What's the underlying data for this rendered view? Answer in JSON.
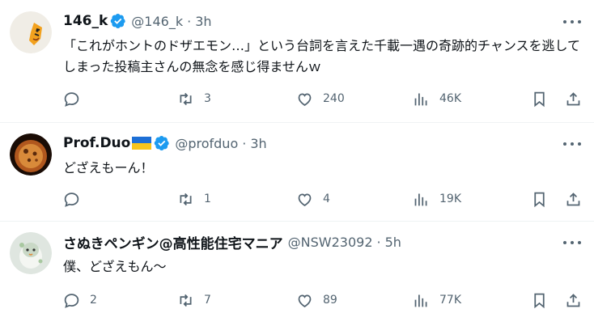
{
  "posts": [
    {
      "name": "146_k",
      "handle": "@146_k",
      "time": "3h",
      "text": "「これがホントのドザエモン…」という台詞を言えた千載一遇の奇跡的チャンスを逃してしまった投稿主さんの無念を感じ得ませんｗ",
      "replies": "",
      "reposts": "3",
      "likes": "240",
      "views": "46K",
      "verified": true,
      "flag": false
    },
    {
      "name": "Prof.Duo",
      "handle": "@profduo",
      "time": "3h",
      "text": "どざえもーん！",
      "replies": "",
      "reposts": "1",
      "likes": "4",
      "views": "19K",
      "verified": true,
      "flag": true
    },
    {
      "name": "さぬきペンギン@高性能住宅マニア",
      "handle": "@NSW23092",
      "time": "5h",
      "text": "僕、どざえもん〜",
      "replies": "2",
      "reposts": "7",
      "likes": "89",
      "views": "77K",
      "verified": false,
      "flag": false
    }
  ],
  "colors": {
    "accent": "#1d9bf0",
    "muted": "#536471",
    "text": "#0f1419",
    "divider": "#eff3f4"
  },
  "icons": [
    "reply-icon",
    "repost-icon",
    "like-icon",
    "views-icon",
    "bookmark-icon",
    "share-icon",
    "more-icon",
    "verified-badge-icon",
    "ukraine-flag-icon"
  ]
}
